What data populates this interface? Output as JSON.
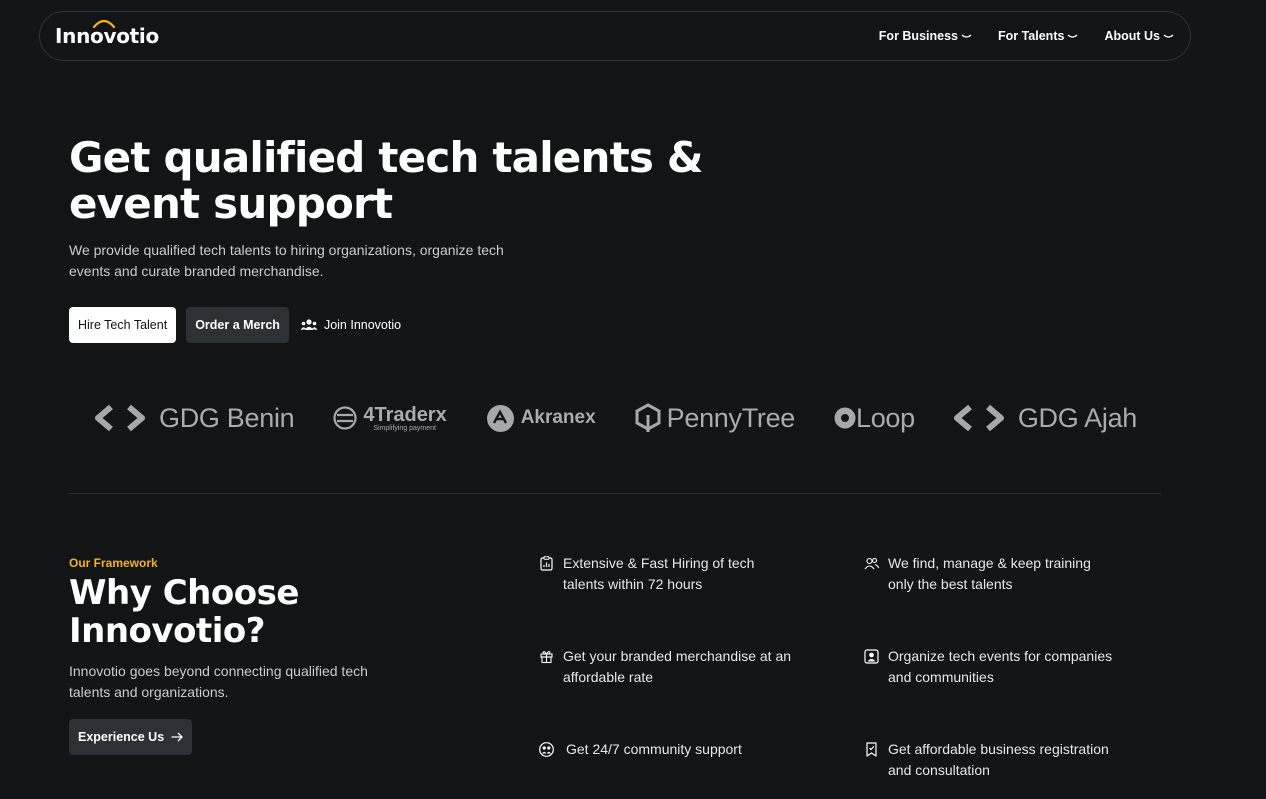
{
  "colors": {
    "background": "#121416",
    "accent": "#f5b320",
    "button_dark": "#2d3034",
    "button_light": "#ffffff"
  },
  "nav": {
    "logo": "Innovotio",
    "links": [
      {
        "label": "For Business",
        "icon": "chevron-down-icon"
      },
      {
        "label": "For Talents",
        "icon": "chevron-down-icon"
      },
      {
        "label": "About Us",
        "icon": "chevron-down-icon"
      }
    ]
  },
  "hero": {
    "title": "Get qualified tech talents & event support",
    "subtitle": "We provide qualified tech talents to hiring organizations, organize tech events and curate branded merchandise.",
    "buttons": {
      "hire": "Hire Tech Talent",
      "order": "Order a Merch",
      "join": "Join Innovotio"
    }
  },
  "partners": [
    {
      "name": "GDG Benin"
    },
    {
      "name": "4Traderx",
      "tagline": "Simplifying payment"
    },
    {
      "name": "Akranex"
    },
    {
      "name": "PennyTree"
    },
    {
      "name": "Loop"
    },
    {
      "name": "GDG Ajah"
    }
  ],
  "why": {
    "eyebrow": "Our Framework",
    "title": "Why Choose Innovotio?",
    "subtitle": "Innovotio goes beyond connecting qualified tech talents and organizations.",
    "button": "Experience Us",
    "features": [
      {
        "icon": "clipboard-chart-icon",
        "text": "Extensive & Fast Hiring of tech talents within 72 hours"
      },
      {
        "icon": "users-icon",
        "text": "We find, manage & keep training only the best talents"
      },
      {
        "icon": "gift-icon",
        "text": "Get your branded merchandise at an affordable rate"
      },
      {
        "icon": "user-square-icon",
        "text": "Organize tech events for companies and communities"
      },
      {
        "icon": "community-icon",
        "text": "Get 24/7 community support"
      },
      {
        "icon": "document-badge-icon",
        "text": "Get affordable business registration and consultation"
      }
    ]
  }
}
